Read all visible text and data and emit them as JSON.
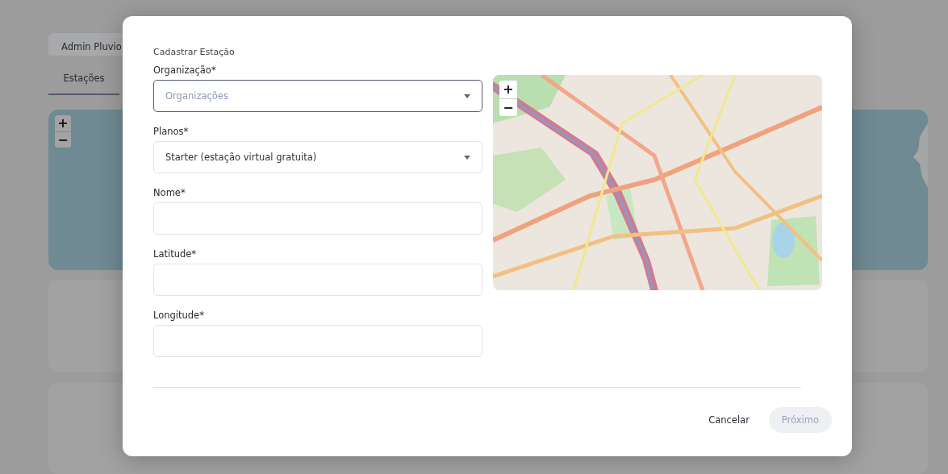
{
  "background": {
    "tabs": [
      {
        "label": "Admin Pluvio",
        "selected": true
      }
    ],
    "subtabs": [
      {
        "label": "Estações",
        "selected": true
      }
    ],
    "map": {
      "zoom_in": "+",
      "zoom_out": "−"
    }
  },
  "dialog": {
    "title": "Cadastrar Estação",
    "fields": [
      {
        "kind": "select",
        "label": "Organização*",
        "placeholder": "Organizações",
        "focused": true
      },
      {
        "kind": "select",
        "label": "Planos*",
        "value": "Starter (estação virtual gratuita)",
        "focused": false
      },
      {
        "kind": "text",
        "label": "Nome*",
        "focused": false
      },
      {
        "kind": "text",
        "label": "Latitude*",
        "focused": false
      },
      {
        "kind": "text",
        "label": "Longitude*",
        "focused": false
      }
    ],
    "map": {
      "zoom_in": "+",
      "zoom_out": "−"
    },
    "buttons": [
      {
        "label": "Cancelar",
        "kind": "text",
        "disabled": false
      },
      {
        "label": "Próximo",
        "kind": "primary",
        "disabled": true
      }
    ]
  }
}
